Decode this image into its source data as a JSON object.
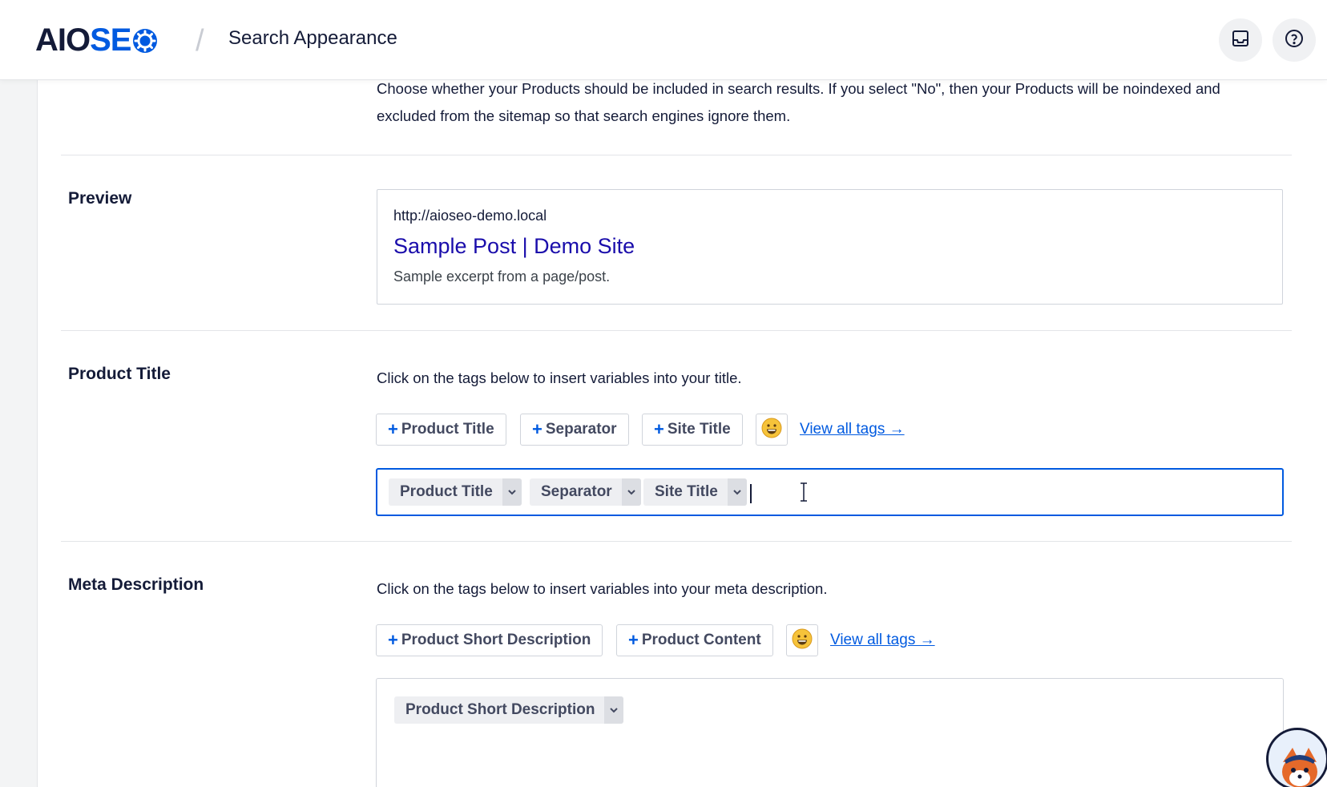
{
  "header": {
    "logo_part1": "AIO",
    "logo_part2": "SE",
    "breadcrumb_separator": "/",
    "page_title": "Search Appearance"
  },
  "intro": {
    "description": "Choose whether your Products should be included in search results. If you select \"No\", then your Products will be noindexed and excluded from the sitemap so that search engines ignore them."
  },
  "preview": {
    "label": "Preview",
    "url": "http://aioseo-demo.local",
    "title": "Sample Post | Demo Site",
    "excerpt": "Sample excerpt from a page/post."
  },
  "product_title": {
    "label": "Product Title",
    "instructions": "Click on the tags below to insert variables into your title.",
    "tag_buttons": [
      {
        "label": "Product Title"
      },
      {
        "label": "Separator"
      },
      {
        "label": "Site Title"
      }
    ],
    "view_all_label": "View all tags →",
    "chips": [
      {
        "label": "Product Title"
      },
      {
        "label": "Separator"
      },
      {
        "label": "Site Title"
      }
    ]
  },
  "meta_description": {
    "label": "Meta Description",
    "instructions": "Click on the tags below to insert variables into your meta description.",
    "tag_buttons": [
      {
        "label": "Product Short Description"
      },
      {
        "label": "Product Content"
      }
    ],
    "view_all_label": "View all tags →",
    "chips": [
      {
        "label": "Product Short Description"
      }
    ]
  },
  "colors": {
    "brand_blue": "#005ae0",
    "text_dark": "#141b38",
    "link_serp": "#1a0dab"
  },
  "icons": {
    "plus": "+",
    "inbox": "inbox-icon",
    "help": "help-icon",
    "emoji": "emoji-icon",
    "chevron": "chevron-down-icon"
  }
}
